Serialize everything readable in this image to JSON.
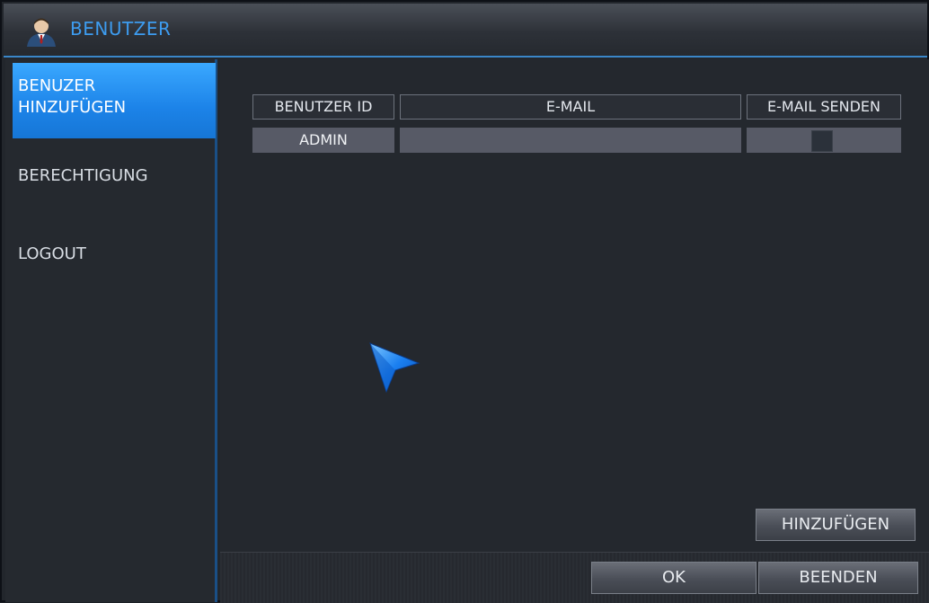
{
  "window": {
    "title": "BENUTZER",
    "title_icon": "user-icon"
  },
  "sidebar": {
    "items": [
      {
        "label": "BENUZER\nHINZUFÜGEN",
        "line1": "BENUZER",
        "line2": "HINZUFÜGEN",
        "active": true
      },
      {
        "label": "BERECHTIGUNG",
        "active": false
      },
      {
        "label": "LOGOUT",
        "active": false
      }
    ]
  },
  "table": {
    "columns": [
      "BENUTZER ID",
      "E-MAIL",
      "E-MAIL SENDEN"
    ],
    "rows": [
      {
        "user_id": "ADMIN",
        "email": "",
        "send_email": false
      }
    ]
  },
  "buttons": {
    "add": "HINZUFÜGEN",
    "ok": "OK",
    "exit": "BEENDEN"
  },
  "colors": {
    "accent": "#1c83e8",
    "title_text": "#3d9cf0",
    "background": "#24282e"
  }
}
